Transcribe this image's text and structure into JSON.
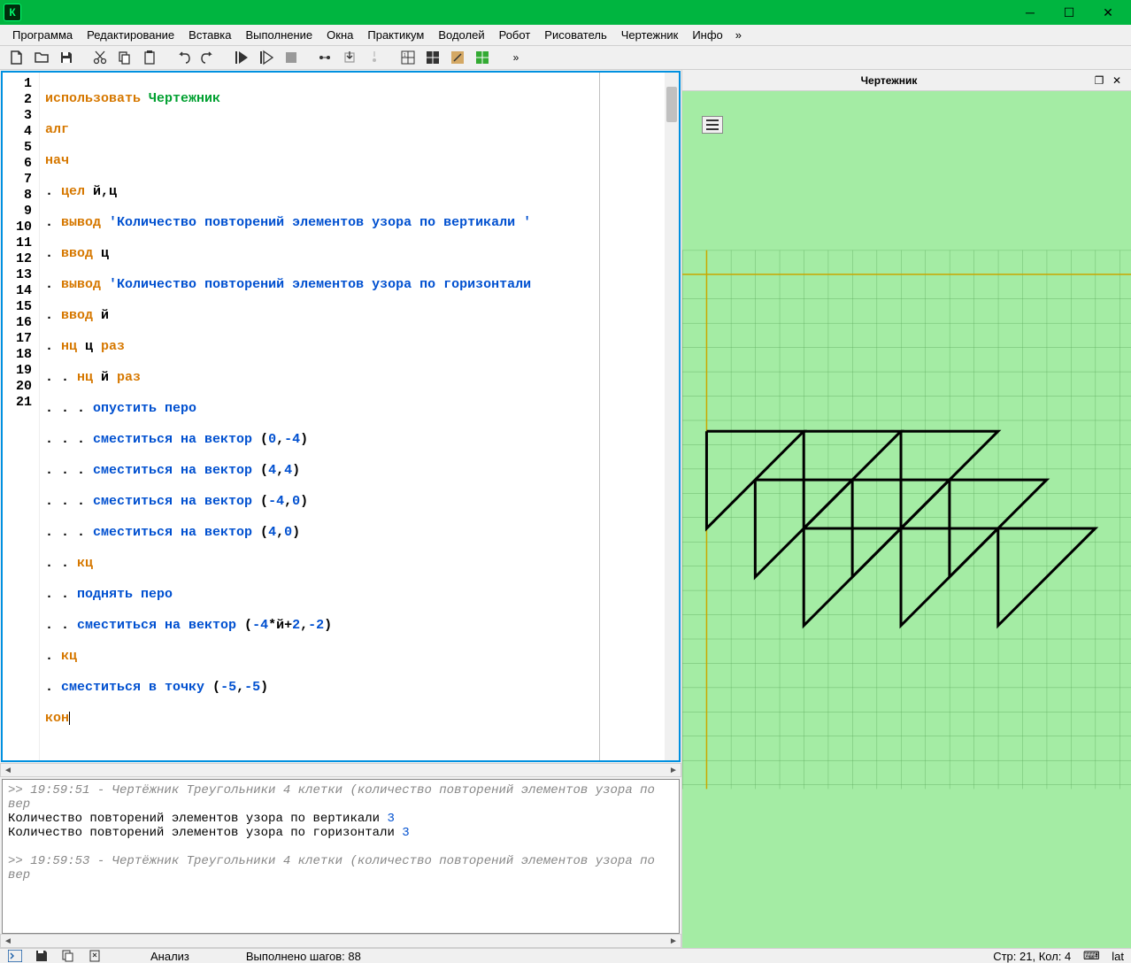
{
  "window": {
    "app_letter": "К"
  },
  "menu": {
    "items": [
      "Программа",
      "Редактирование",
      "Вставка",
      "Выполнение",
      "Окна",
      "Практикум",
      "Водолей",
      "Робот",
      "Рисователь",
      "Чертежник",
      "Инфо"
    ],
    "overflow": "»"
  },
  "toolbar": {
    "overflow": "»"
  },
  "code": {
    "lines_count": 21,
    "l1_a": "использовать ",
    "l1_b": "Чертежник",
    "l2": "алг",
    "l3": "нач",
    "l4_a": ". ",
    "l4_b": "цел",
    "l4_c": " й,ц",
    "l5_a": ". ",
    "l5_b": "вывод",
    "l5_c": " ",
    "l5_d": "'Количество повторений элементов узора по вертикали '",
    "l6_a": ". ",
    "l6_b": "ввод",
    "l6_c": " ц",
    "l7_a": ". ",
    "l7_b": "вывод",
    "l7_c": " ",
    "l7_d": "'Количество повторений элементов узора по горизонтали",
    "l8_a": ". ",
    "l8_b": "ввод",
    "l8_c": " й",
    "l9_a": ". ",
    "l9_b": "нц",
    "l9_c": " ц ",
    "l9_d": "раз",
    "l10_a": ". . ",
    "l10_b": "нц",
    "l10_c": " й ",
    "l10_d": "раз",
    "l11_a": ". . . ",
    "l11_b": "опустить перо",
    "l12_a": ". . . ",
    "l12_b": "сместиться на вектор",
    "l12_c": " (",
    "l12_d": "0",
    "l12_e": ",",
    "l12_f": "-4",
    "l12_g": ")",
    "l13_a": ". . . ",
    "l13_b": "сместиться на вектор",
    "l13_c": " (",
    "l13_d": "4",
    "l13_e": ",",
    "l13_f": "4",
    "l13_g": ")",
    "l14_a": ". . . ",
    "l14_b": "сместиться на вектор",
    "l14_c": " (",
    "l14_d": "-4",
    "l14_e": ",",
    "l14_f": "0",
    "l14_g": ")",
    "l15_a": ". . . ",
    "l15_b": "сместиться на вектор",
    "l15_c": " (",
    "l15_d": "4",
    "l15_e": ",",
    "l15_f": "0",
    "l15_g": ")",
    "l16_a": ". . ",
    "l16_b": "кц",
    "l17_a": ". . ",
    "l17_b": "поднять перо",
    "l18_a": ". . ",
    "l18_b": "сместиться на вектор",
    "l18_c": " (",
    "l18_d": "-4",
    "l18_e": "*й+",
    "l18_f": "2",
    "l18_g": ",",
    "l18_h": "-2",
    "l18_i": ")",
    "l19_a": ". ",
    "l19_b": "кц",
    "l20_a": ". ",
    "l20_b": "сместиться в точку",
    "l20_c": " (",
    "l20_d": "-5",
    "l20_e": ",",
    "l20_f": "-5",
    "l20_g": ")",
    "l21": "кон"
  },
  "console": {
    "ts1": ">> 19:59:51 - Чертёжник Треугольники 4 клетки (количество повторений элементов узора по вер",
    "prompt_v": "Количество повторений элементов узора по вертикали ",
    "val_v": "3",
    "prompt_h": "Количество повторений элементов узора по горизонтали ",
    "val_h": "3",
    "ts2": ">> 19:59:53 - Чертёжник Треугольники 4 клетки (количество повторений элементов узора по вер"
  },
  "drafter": {
    "title": "Чертежник"
  },
  "status": {
    "analysis": "Анализ",
    "steps": "Выполнено шагов: 88",
    "cursor": "Стр: 21, Кол: 4",
    "lang": "lat"
  }
}
